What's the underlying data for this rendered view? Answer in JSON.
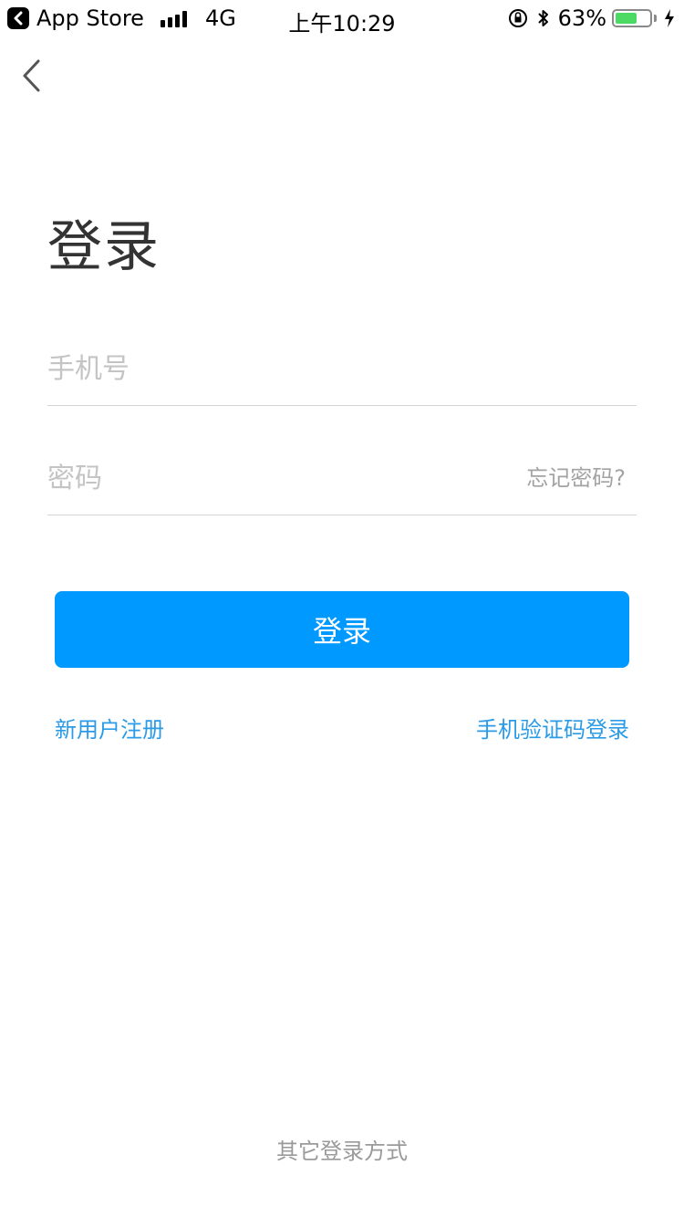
{
  "status_bar": {
    "back_app_label": "App Store",
    "network": "4G",
    "time": "上午10:29",
    "battery_percent": "63%",
    "battery_level": 0.63,
    "battery_color": "#4cd964"
  },
  "nav": {
    "back_icon": "chevron-left-icon"
  },
  "login": {
    "title": "登录",
    "phone_placeholder": "手机号",
    "password_placeholder": "密码",
    "forgot_password": "忘记密码?",
    "submit_label": "登录",
    "register_link": "新用户注册",
    "sms_login_link": "手机验证码登录",
    "other_login": "其它登录方式"
  },
  "colors": {
    "accent": "#0099ff",
    "link": "#2b9be8"
  }
}
